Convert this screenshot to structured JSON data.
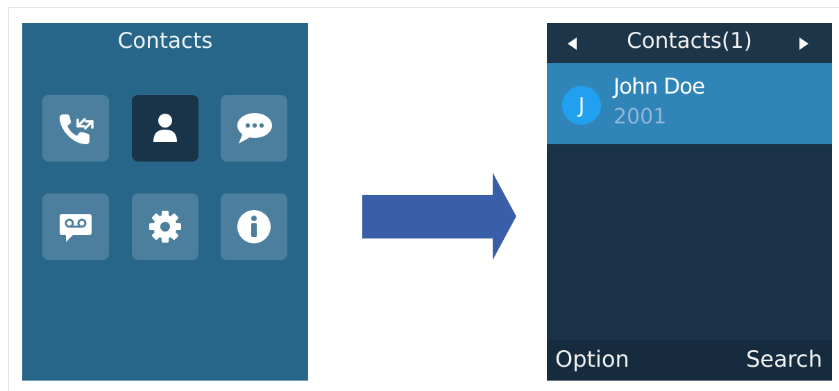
{
  "menu_screen": {
    "title": "Contacts",
    "tiles": [
      {
        "icon": "call-history-icon",
        "selected": false
      },
      {
        "icon": "contacts-icon",
        "selected": true
      },
      {
        "icon": "messages-icon",
        "selected": false
      },
      {
        "icon": "voicemail-icon",
        "selected": false
      },
      {
        "icon": "settings-gear-icon",
        "selected": false
      },
      {
        "icon": "info-icon",
        "selected": false
      }
    ]
  },
  "arrow": {
    "color": "#3b5ea8",
    "direction": "right"
  },
  "contacts_screen": {
    "title": "Contacts(1)",
    "contacts": [
      {
        "initial": "J",
        "name": "John Doe",
        "number": "2001"
      }
    ],
    "softkeys": {
      "left": "Option",
      "right": "Search"
    }
  },
  "colors": {
    "menu_background": "#286689",
    "tile": "#4c7f9d",
    "tile_selected": "#193349",
    "list_background": "#1a3248",
    "row_highlight": "#2f84b8",
    "avatar": "#22a0f0"
  }
}
